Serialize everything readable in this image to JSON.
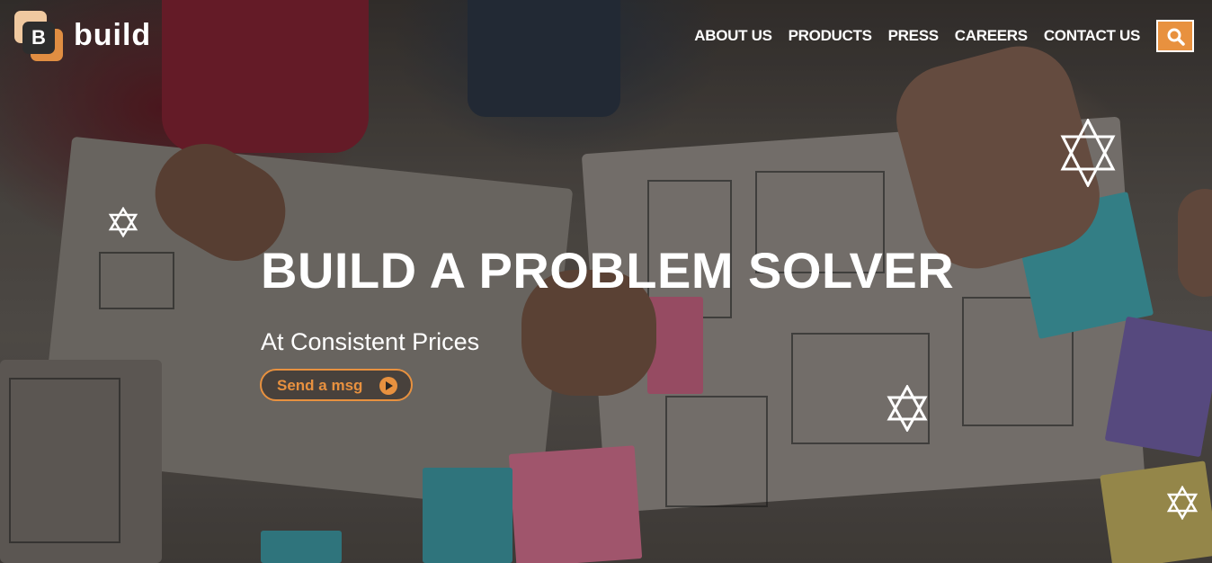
{
  "brand": {
    "logo_letter": "B",
    "name": "build"
  },
  "nav": {
    "items": [
      "ABOUT US",
      "PRODUCTS",
      "PRESS",
      "CAREERS",
      "CONTACT US"
    ]
  },
  "search": {
    "icon": "search-icon"
  },
  "hero": {
    "title": "BUILD A PROBLEM SOLVER",
    "subtitle": "At Consistent Prices",
    "cta_label": "Send a msg",
    "cta_icon": "play-circle-icon"
  },
  "colors": {
    "accent": "#e8913f",
    "text": "#ffffff"
  }
}
